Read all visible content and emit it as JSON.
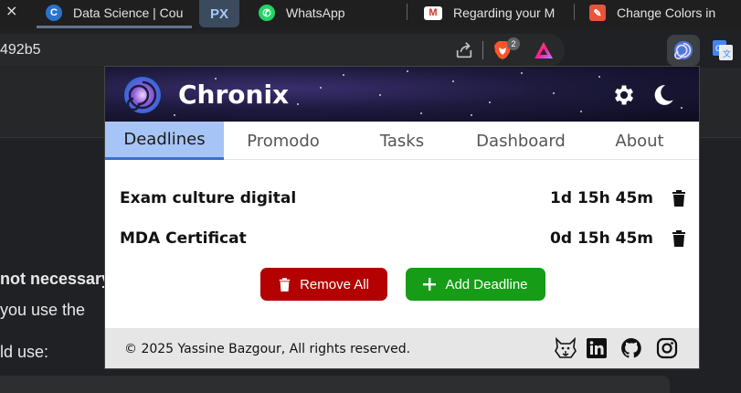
{
  "browser": {
    "tabs": [
      {
        "label": "Data Science | Cou",
        "icon": "coursera-icon"
      },
      {
        "label": "PX",
        "icon": "px-icon"
      },
      {
        "label": "WhatsApp",
        "icon": "whatsapp-icon"
      },
      {
        "label": "Regarding your M",
        "icon": "gmail-icon"
      },
      {
        "label": "Change Colors in",
        "icon": "tool-icon"
      }
    ],
    "close_glyph": "×",
    "url_fragment": "492b5",
    "brave_badge_count": "2"
  },
  "background_page": {
    "lines": [
      "not necessary",
      "you use the",
      "ld use:"
    ]
  },
  "popup": {
    "title": "Chronix",
    "tabs": [
      "Deadlines",
      "Promodo",
      "Tasks",
      "Dashboard",
      "About"
    ],
    "active_tab": "Deadlines",
    "deadlines": [
      {
        "name": "Exam culture digital",
        "remaining": "1d 15h 45m"
      },
      {
        "name": "MDA Certificat",
        "remaining": "0d 15h 45m"
      }
    ],
    "remove_all_label": "Remove All",
    "add_deadline_label": "Add Deadline",
    "footer_text": "© 2025 Yassine Bazgour, All rights reserved.",
    "social_icons": [
      "wolf-logo-icon",
      "linkedin-icon",
      "github-icon",
      "instagram-icon"
    ]
  },
  "colors": {
    "banner": "#1d1a3d",
    "active_tab_bg": "#a7c4f7",
    "remove_button": "#b30000",
    "add_button": "#169c16",
    "footer_bg": "#e6e6e6"
  }
}
